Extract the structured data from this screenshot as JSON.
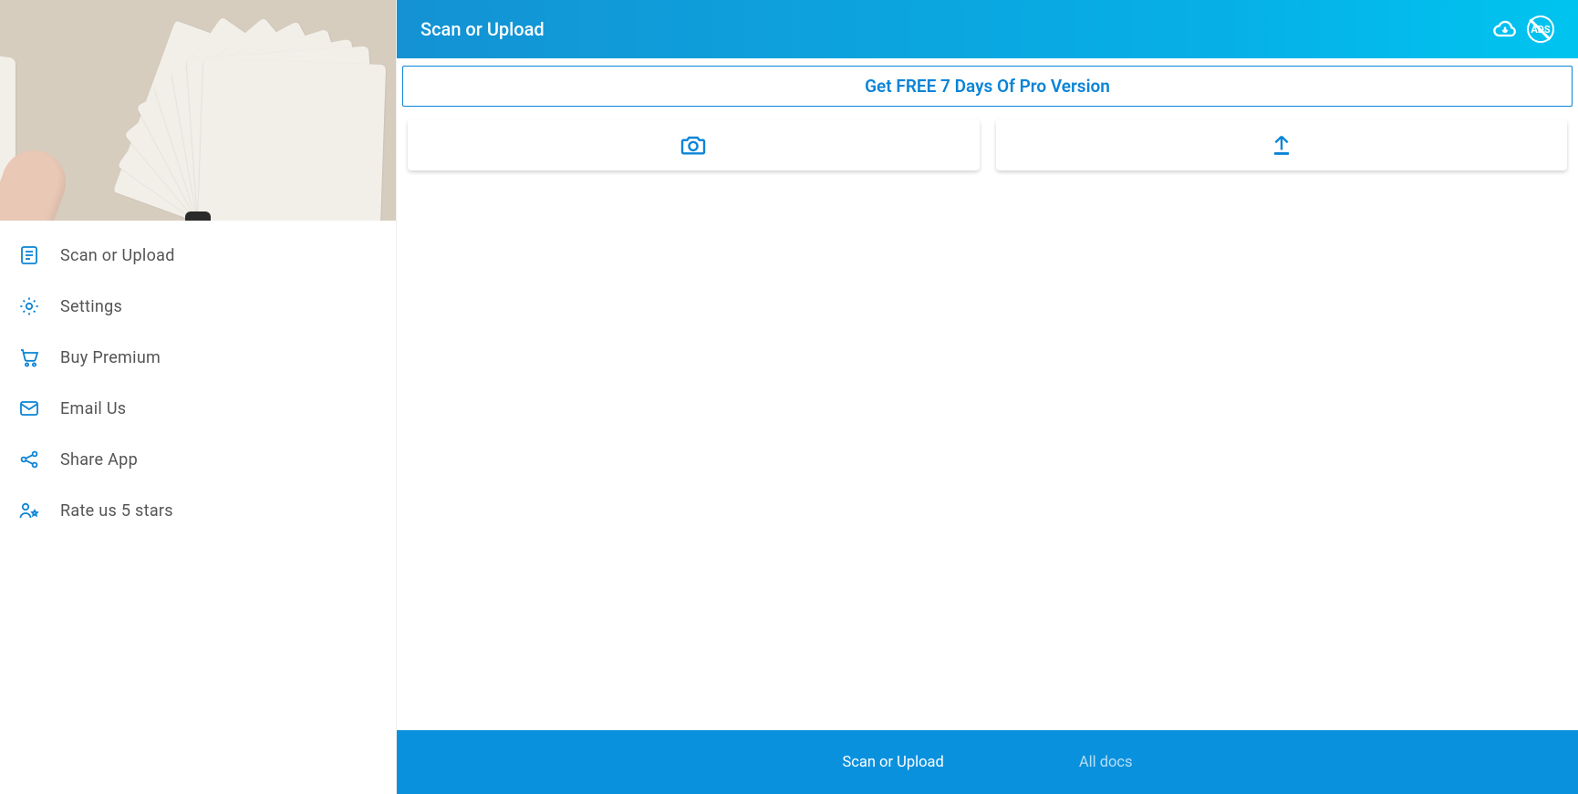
{
  "colors": {
    "accent": "#0a84d6"
  },
  "header": {
    "title": "Scan or Upload",
    "icons": {
      "cloud": "cloud-download-icon",
      "noads": "no-ads-icon",
      "noads_text": "ADS"
    }
  },
  "promo": {
    "label": "Get FREE 7 Days Of Pro Version"
  },
  "actions": {
    "scan": "camera-icon",
    "upload": "upload-icon"
  },
  "sidebar": {
    "items": [
      {
        "icon": "document-icon",
        "label": "Scan or Upload"
      },
      {
        "icon": "gear-icon",
        "label": "Settings"
      },
      {
        "icon": "cart-icon",
        "label": "Buy Premium"
      },
      {
        "icon": "mail-icon",
        "label": "Email Us"
      },
      {
        "icon": "share-icon",
        "label": "Share App"
      },
      {
        "icon": "rate-icon",
        "label": "Rate us 5 stars"
      }
    ]
  },
  "tabs": {
    "items": [
      {
        "label": "Scan or Upload",
        "active": true
      },
      {
        "label": "All docs",
        "active": false
      }
    ]
  }
}
